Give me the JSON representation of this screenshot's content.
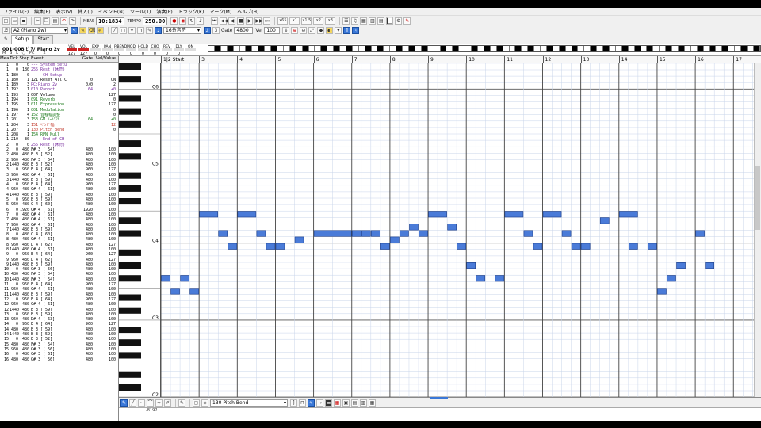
{
  "menu": [
    "ファイル(F)",
    "編集(E)",
    "表示(V)",
    "挿入(I)",
    "イベント(N)",
    "ツール(T)",
    "演奏(P)",
    "トラック(K)",
    "マーク(M)",
    "ヘルプ(H)"
  ],
  "toolbar1": {
    "time_label": "MEAS",
    "time_value": "10:1834",
    "tempo_label": "TEMPO",
    "tempo_value": "250.00",
    "zoom_buttons": [
      "x65",
      "x1",
      "x1.5",
      "x2",
      "x3"
    ]
  },
  "toolbar2": {
    "port_select": "A2 (Piano 2w)",
    "quantize_select": "16分音符",
    "gate_label": "Gate",
    "gate_value": "4800",
    "vel_label": "Vel",
    "vel_value": "100"
  },
  "tabs": [
    "Setup",
    "Start"
  ],
  "track": {
    "name": "001-008 ﾋﾟｱﾉ Piano 2v",
    "sub": [
      "M",
      "S",
      "L",
      "○",
      "PC",
      "2"
    ],
    "meters": [
      {
        "label": "VEL",
        "value": "127"
      },
      {
        "label": "VOL",
        "value": "127"
      },
      {
        "label": "EXP",
        "value": "0"
      },
      {
        "label": "PAN",
        "value": "0"
      },
      {
        "label": "P.BEND",
        "value": "0"
      },
      {
        "label": "MOD",
        "value": "0"
      },
      {
        "label": "HOLD",
        "value": "0"
      },
      {
        "label": "CHO",
        "value": "0"
      },
      {
        "label": "REV",
        "value": "0"
      },
      {
        "label": "DLY",
        "value": "0"
      },
      {
        "label": "ON",
        "value": ""
      }
    ]
  },
  "event_list": {
    "headers": [
      "Mea",
      "Tick",
      "Step",
      "Event",
      "Gate",
      "Vel/Value"
    ],
    "rows": [
      [
        "1",
        "0",
        "0",
        "--- System Setup --------",
        "",
        ""
      ],
      [
        "1",
        "0",
        "180",
        "255 Rest (休符)",
        "",
        ""
      ],
      [
        "1",
        "180",
        "0",
        "---- CH Setup -----------",
        "",
        ""
      ],
      [
        "1",
        "180",
        "1",
        "121 Reset All Control",
        "0",
        "ON"
      ],
      [
        "1",
        "189",
        "3",
        "PC:Piano 2v",
        "0/0",
        "2"
      ],
      [
        "1",
        "192",
        "1",
        "010 Panpot",
        "64",
        "±0"
      ],
      [
        "1",
        "193",
        "1",
        "007 Volume",
        "",
        "127"
      ],
      [
        "1",
        "194",
        "1",
        "091 Reverb",
        "",
        "0"
      ],
      [
        "1",
        "195",
        "1",
        "011 Expression",
        "",
        "127"
      ],
      [
        "1",
        "196",
        "1",
        "001 Modulation",
        "",
        "0"
      ],
      [
        "1",
        "197",
        "4",
        "152 音程幅調整",
        "",
        "0"
      ],
      [
        "1",
        "201",
        "3",
        "153 GM ﾉｰﾄｼﾌﾄ",
        "64",
        "±0"
      ],
      [
        "1",
        "204",
        "3",
        "151 ﾍﾞﾝﾄﾞ幅",
        "",
        "12"
      ],
      [
        "1",
        "207",
        "1",
        "130 Pitch Bend",
        "",
        "0"
      ],
      [
        "1",
        "208",
        "1",
        "154 RPN Null",
        "",
        ""
      ],
      [
        "1",
        "210",
        "30",
        "---- End of CH Setup -----",
        "",
        ""
      ],
      [
        "2",
        "0",
        "0",
        "255 Rest (休符)",
        "",
        ""
      ],
      [
        "2",
        "0",
        "480",
        "F# 3 [ 54]",
        "480",
        "100"
      ],
      [
        "2",
        "480",
        "480",
        "E  3 [ 52]",
        "480",
        "100"
      ],
      [
        "2",
        "960",
        "480",
        "F# 3 [ 54]",
        "480",
        "100"
      ],
      [
        "2",
        "1440",
        "480",
        "E  3 [ 52]",
        "480",
        "100"
      ],
      [
        "3",
        "0",
        "960",
        "E  4 [ 64]",
        "960",
        "127"
      ],
      [
        "3",
        "960",
        "480",
        "C# 4 [ 61]",
        "480",
        "100"
      ],
      [
        "3",
        "1440",
        "480",
        "B  3 [ 59]",
        "480",
        "100"
      ],
      [
        "4",
        "0",
        "960",
        "E  4 [ 64]",
        "960",
        "127"
      ],
      [
        "4",
        "960",
        "480",
        "C# 4 [ 61]",
        "480",
        "100"
      ],
      [
        "4",
        "1440",
        "480",
        "B  3 [ 59]",
        "480",
        "100"
      ],
      [
        "5",
        "0",
        "960",
        "B  3 [ 59]",
        "480",
        "100"
      ],
      [
        "5",
        "960",
        "480",
        "C  4 [ 60]",
        "480",
        "100"
      ],
      [
        "6",
        "0",
        "1920",
        "C# 4 [ 61]",
        "1920",
        "100"
      ],
      [
        "7",
        "0",
        "480",
        "C# 4 [ 61]",
        "480",
        "100"
      ],
      [
        "7",
        "480",
        "480",
        "C# 4 [ 61]",
        "480",
        "100"
      ],
      [
        "7",
        "960",
        "480",
        "C# 4 [ 61]",
        "480",
        "100"
      ],
      [
        "7",
        "1440",
        "480",
        "B  3 [ 59]",
        "480",
        "100"
      ],
      [
        "8",
        "0",
        "480",
        "C  4 [ 60]",
        "480",
        "100"
      ],
      [
        "8",
        "480",
        "480",
        "C# 4 [ 61]",
        "480",
        "100"
      ],
      [
        "8",
        "960",
        "480",
        "D  4 [ 62]",
        "480",
        "127"
      ],
      [
        "8",
        "1440",
        "480",
        "C# 4 [ 61]",
        "480",
        "100"
      ],
      [
        "9",
        "0",
        "960",
        "E  4 [ 64]",
        "960",
        "127"
      ],
      [
        "9",
        "960",
        "480",
        "D  4 [ 62]",
        "480",
        "127"
      ],
      [
        "9",
        "1440",
        "480",
        "B  3 [ 59]",
        "480",
        "100"
      ],
      [
        "10",
        "0",
        "480",
        "G# 3 [ 56]",
        "480",
        "100"
      ],
      [
        "10",
        "480",
        "480",
        "F# 3 [ 54]",
        "480",
        "100"
      ],
      [
        "10",
        "1440",
        "480",
        "F# 3 [ 54]",
        "480",
        "100"
      ],
      [
        "11",
        "0",
        "960",
        "E  4 [ 64]",
        "960",
        "127"
      ],
      [
        "11",
        "960",
        "480",
        "C# 4 [ 61]",
        "480",
        "100"
      ],
      [
        "11",
        "1440",
        "480",
        "B  3 [ 59]",
        "480",
        "100"
      ],
      [
        "12",
        "0",
        "960",
        "E  4 [ 64]",
        "960",
        "127"
      ],
      [
        "12",
        "960",
        "480",
        "C# 4 [ 61]",
        "480",
        "100"
      ],
      [
        "12",
        "1440",
        "480",
        "B  3 [ 59]",
        "480",
        "100"
      ],
      [
        "13",
        "0",
        "960",
        "B  3 [ 59]",
        "480",
        "100"
      ],
      [
        "13",
        "960",
        "480",
        "D# 4 [ 63]",
        "480",
        "100"
      ],
      [
        "14",
        "0",
        "960",
        "E  4 [ 64]",
        "960",
        "127"
      ],
      [
        "14",
        "480",
        "480",
        "B  3 [ 59]",
        "480",
        "100"
      ],
      [
        "14",
        "1440",
        "480",
        "B  3 [ 59]",
        "480",
        "100"
      ],
      [
        "15",
        "0",
        "480",
        "E  3 [ 52]",
        "480",
        "100"
      ],
      [
        "15",
        "480",
        "480",
        "F# 3 [ 54]",
        "480",
        "100"
      ],
      [
        "15",
        "960",
        "480",
        "G# 3 [ 56]",
        "480",
        "100"
      ],
      [
        "16",
        "0",
        "480",
        "C# 3 [ 61]",
        "480",
        "100"
      ],
      [
        "16",
        "480",
        "480",
        "G# 3 [ 56]",
        "480",
        "100"
      ]
    ]
  },
  "ruler": {
    "labels": [
      "1|2 Start",
      "3",
      "4",
      "5",
      "6",
      "7",
      "8",
      "9",
      "10",
      "11",
      "12",
      "13",
      "14",
      "15",
      "16",
      "17"
    ]
  },
  "octave_labels": [
    "C6",
    "C5",
    "C4",
    "C3",
    "C2"
  ],
  "controller": {
    "select": "130 Pitch Bend",
    "value_label": "-8192"
  },
  "note_color": "#4a7bd8",
  "grid_line_color": "#c8d4ea"
}
